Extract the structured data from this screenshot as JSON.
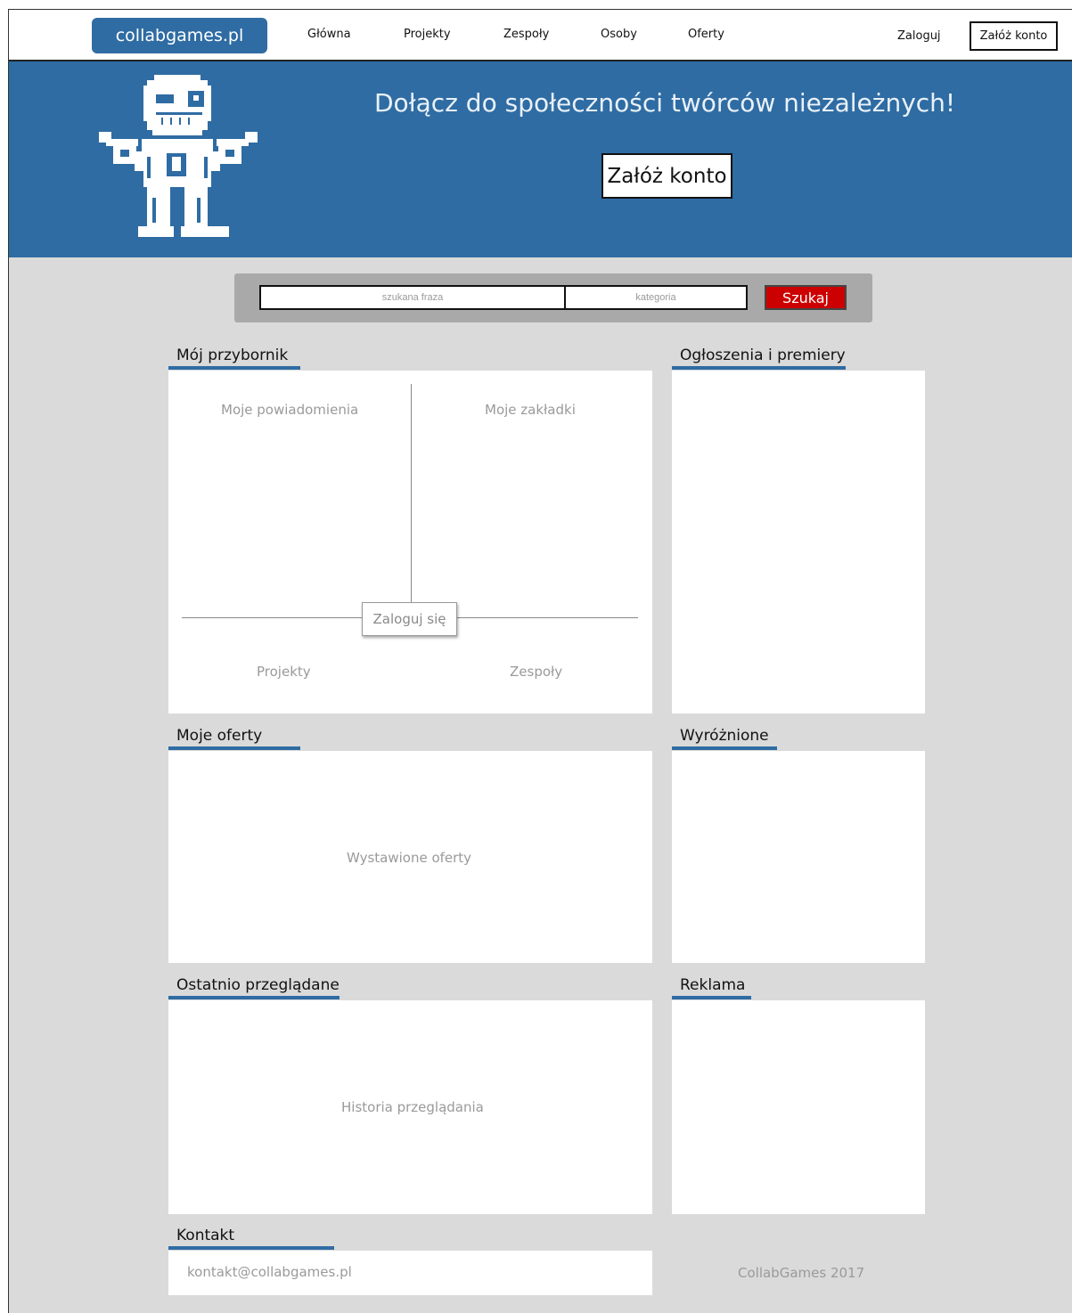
{
  "header": {
    "logo": "collabgames.pl",
    "nav": [
      "Główna",
      "Projekty",
      "Zespoły",
      "Osoby",
      "Oferty"
    ],
    "login": "Zaloguj",
    "register": "Załóż konto"
  },
  "hero": {
    "title": "Dołącz do społeczności twórców niezależnych!",
    "cta": "Załóż konto"
  },
  "search": {
    "phrase_placeholder": "szukana fraza",
    "category_placeholder": "kategoria",
    "button": "Szukaj"
  },
  "toolbox": {
    "title": "Mój przybornik",
    "notifications": "Moje powiadomienia",
    "bookmarks": "Moje zakładki",
    "projects": "Projekty",
    "teams": "Zespoły",
    "login": "Zaloguj się"
  },
  "news": {
    "title": "Ogłoszenia i premiery"
  },
  "offers": {
    "title": "Moje oferty",
    "content": "Wystawione oferty"
  },
  "featured": {
    "title": "Wyróżnione"
  },
  "recent": {
    "title": "Ostatnio przeglądane",
    "content": "Historia przeglądania"
  },
  "ads": {
    "title": "Reklama"
  },
  "contact": {
    "title": "Kontakt",
    "email": "kontakt@collabgames.pl"
  },
  "footer": {
    "copyright": "CollabGames 2017"
  },
  "colors": {
    "primary": "#2f6ca3",
    "background": "#dadada",
    "search_button": "#cc0000"
  }
}
